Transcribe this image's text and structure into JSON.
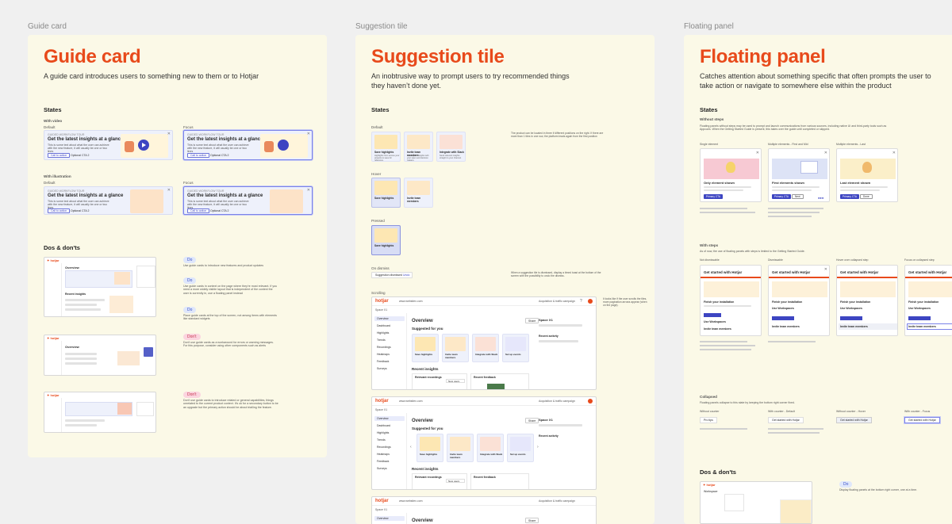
{
  "frames": [
    {
      "label": "Guide card"
    },
    {
      "label": "Suggestion tile"
    },
    {
      "label": "Floating panel"
    }
  ],
  "guide": {
    "title": "Guide card",
    "subtitle": "A guide card introduces users to something new to them or to Hotjar",
    "states": "States",
    "with_video": "With video",
    "with_illustration": "With illustration",
    "default": "Default",
    "focus": "Focus",
    "card_tag": "GUIDED WORKFLOW TOUR",
    "card_title": "Get the latest insights at a glance",
    "card_body": "This is some text about what the user can achieve with the new feature, it will usually be one or two lines",
    "cta_primary": "Call to action",
    "cta_optional": "Optional CTA 2",
    "dos_donts": "Dos & don'ts",
    "do": "Do",
    "dont": "Don't",
    "note1": "Use guide cards to introduce new features and product updates",
    "note2": "Use guide cards in context on the page where they're most relevant. If you need a more widely visible layout that is independent of the context the user is currently in, use a floating panel instead",
    "note3": "Place guide cards at the top of the screen, not among items with elements like standard widgets",
    "note4": "Don't use guide cards as a workaround for errors or warning messages. For this purpose, consider using other components such as alerts",
    "note5": "Don't use guide cards to introduce related or general capabilities, things unrelated to the current product context. It's ok for a secondary button to be an upgrade but the primary action should be about trialling the feature.",
    "mock_overview": "Overview",
    "mock_recent": "Recent insights"
  },
  "suggestion": {
    "title": "Suggestion tile",
    "subtitle": "An inobtrusive way to prompt users to try recommended things they haven’t done yet.",
    "states": "States",
    "default": "Default",
    "hover": "Hover",
    "pressed": "Pressed",
    "on_dismiss": "On dismiss",
    "scrolling": "Scrolling",
    "note_default": "The product can be located in three if different positions on the right. If there are more than 1 tiles in one row, the platform leads again from the first position",
    "note_dismiss": "When a suggestion tile is dismissed, display a timed toast at the bottom of the screen with the possibility to undo the dismiss.",
    "note_scroll": "It looks like if the user scrolls the tiles, more pagination arrows appear (when on the page).",
    "toast_text": "Suggestion dismissed",
    "toast_undo": "Undo",
    "tiles": [
      {
        "title": "Save highlights",
        "body": "Highlights from across your projects to save for reference."
      },
      {
        "title": "Invite team members",
        "body": "Share your insights with your team and decision makers."
      },
      {
        "title": "Integrate with Slack",
        "body": "Send relevant insights straight to your channel."
      },
      {
        "title": "Set up events",
        "body": "Set up events to track specific user actions on your site."
      }
    ],
    "app": {
      "logo": "hotjar",
      "site": "www.websitex.com",
      "team": "Acquisition & traffic campaign",
      "crumb": "Space X1",
      "crumb2": "Overview",
      "nav": [
        "Overview",
        "Dashboard",
        "Highlights",
        "Trends",
        "Recordings",
        "Heatmaps",
        "Feedback",
        "Surveys"
      ],
      "overview": "Overview",
      "share": "Share",
      "suggested": "Suggested for you",
      "recent": "Recent insights",
      "recordings": "Relevant recordings",
      "feedback": "Recent feedback",
      "filter": "New users",
      "space_title": "Space X1",
      "recent_activity": "Recent activity"
    }
  },
  "floating": {
    "title": "Floating panel",
    "subtitle": "Catches attention about something specific that often prompts the user to take action or navigate to somewhere else within the product",
    "states": "States",
    "without_steps": "Without steps",
    "intro": "Floating panels without steps may be used to prompt and launch communications from various sources, including native UI and third-party tools such as Appcues. When the Getting Started Guide is present, this takes over the guide until completed or skipped.",
    "single": "Single element",
    "multiple_first": "Multiple elements - First and Mid",
    "multiple_last": "Multiple elements - Last",
    "p1_title": "Only element shown",
    "p2_title": "First elements shown",
    "p3_title": "Last element shown",
    "primary": "Primary CTA",
    "next": "Next",
    "done": "Done",
    "with_steps": "With steps",
    "with_steps_intro": "As of now, the use of floating panels with steps is limited to the Getting Started Guide.",
    "not_dismissable": "Not dismissable",
    "dismissable": "Dismissable",
    "hover_collapsed": "Hover over collapsed step",
    "focus_collapsed": "Focus on collapsed step",
    "guide_title": "Get started with Hotjar",
    "step1": "Finish your installation",
    "step2": "Use Workspaces",
    "step3": "Invite team members",
    "collapsed": "Collapsed",
    "collapsed_intro": "Floating panels collapse to this state by keeping the bottom right corner fixed.",
    "without_counter": "Without counter",
    "with_counter_default": "With counter - Default",
    "without_counter_hover": "Without counter - Hover",
    "with_counter_focus": "With counter - Focus",
    "pro_tips": "Pro tips",
    "collapsed_label": "Get started with Hotjar",
    "dos_donts": "Dos & don'ts",
    "do": "Do",
    "do_note": "Display floating panels at the bottom right corner, one at a time.",
    "mock_workspace": "Workspace"
  },
  "colors": {
    "accent": "#e84a1b",
    "board": "#fbf9e7",
    "canvas": "#f0f0f0",
    "primary": "#3d45c2"
  }
}
